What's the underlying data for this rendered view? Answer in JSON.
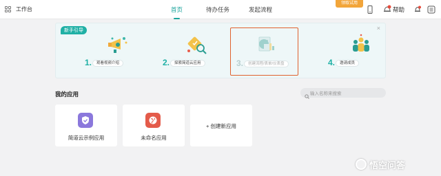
{
  "app": {
    "title": "工作台"
  },
  "nav": {
    "home": "首页",
    "todo": "待办任务",
    "initiate": "发起流程"
  },
  "trial_badge": "领取试用",
  "header_icons": [
    "phone-icon",
    "bell-icon",
    "notification-icon"
  ],
  "notification_count": "1",
  "help_label": "帮助",
  "guide": {
    "tag": "新手引导",
    "close": "×",
    "steps": [
      {
        "num": "1.",
        "label": "观看视频介绍",
        "icon": "video-megaphone-icon"
      },
      {
        "num": "2.",
        "label": "探索简道云应用",
        "icon": "explore-magnifier-icon"
      },
      {
        "num": "3.",
        "label": "创建流程/表单/仪表盘",
        "icon": "create-dashboard-icon"
      },
      {
        "num": "4.",
        "label": "邀请成员",
        "icon": "invite-members-icon"
      }
    ]
  },
  "apps": {
    "title": "我的应用",
    "search_placeholder": "输入名称来搜索",
    "items": [
      {
        "name": "简道云示例应用",
        "icon": "shield-check-icon",
        "color": "#8b78dc"
      },
      {
        "name": "未命名应用",
        "icon": "globe-icon",
        "color": "#e45b4a"
      }
    ],
    "create_label": "+ 创建新应用"
  },
  "colors": {
    "accent": "#1aa39b",
    "trial": "#f2a53a",
    "highlight_border": "#e0602c"
  },
  "watermark": "悟空问答"
}
